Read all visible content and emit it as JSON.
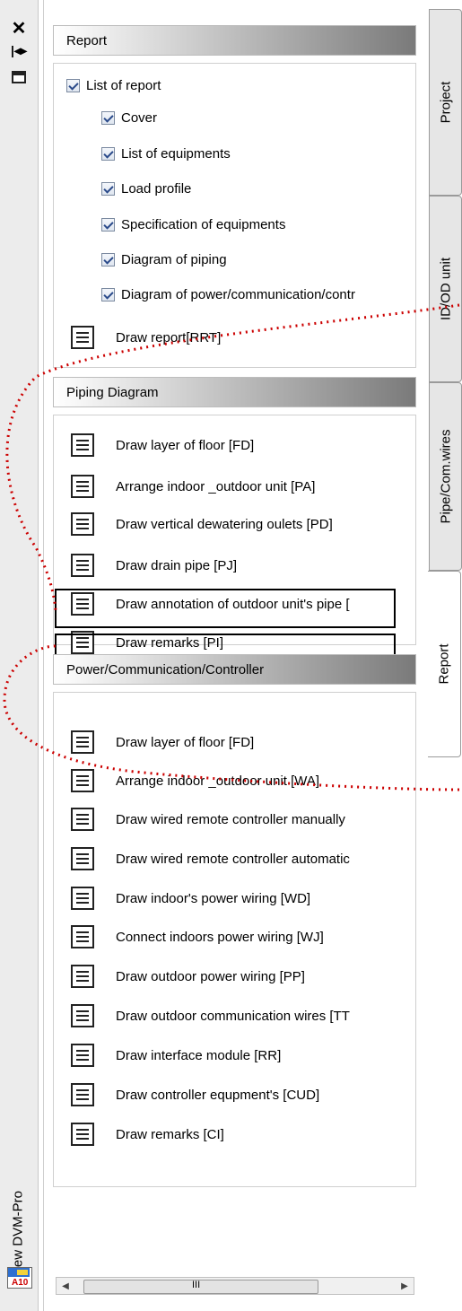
{
  "sidebar": {
    "title": "New DVM-Pro",
    "icons": [
      "close-icon",
      "auto-hide-icon",
      "properties-icon"
    ]
  },
  "tabs": [
    {
      "label": "Project",
      "active": false
    },
    {
      "label": "ID/OD unit",
      "active": false
    },
    {
      "label": "Pipe/Com.wires",
      "active": false
    },
    {
      "label": "Report",
      "active": true
    }
  ],
  "report": {
    "header": "Report",
    "list_label": "List of report",
    "items": [
      {
        "label": "Cover",
        "checked": true
      },
      {
        "label": "List of equipments",
        "checked": true
      },
      {
        "label": "Load profile",
        "checked": true
      },
      {
        "label": "Specification of equipments",
        "checked": true
      },
      {
        "label": "Diagram of piping",
        "checked": true
      },
      {
        "label": "Diagram of power/communication/contr",
        "checked": true
      }
    ],
    "draw_label": "Draw report[RRT]"
  },
  "piping": {
    "header": "Piping Diagram",
    "items": [
      "Draw layer of floor [FD]",
      "Arrange indoor _outdoor unit [PA]",
      "Draw vertical dewatering oulets [PD]",
      "Draw drain pipe [PJ]",
      "Draw annotation of outdoor unit's pipe [",
      "Draw remarks [PI]"
    ]
  },
  "power": {
    "header": "Power/Communication/Controller",
    "items": [
      "Draw layer of floor [FD]",
      "Arrange indoor _outdoor unit [WA]",
      "Draw wired remote controller manually",
      "Draw wired remote controller automatic",
      "Draw indoor's power wiring [WD]",
      "Connect indoors power wiring [WJ]",
      "Draw outdoor power wiring [PP]",
      "Draw outdoor communication wires [TT",
      "Draw interface module [RR]",
      "Draw controller equpment's [CUD]",
      "Draw remarks [CI]"
    ]
  },
  "scrollbar": {
    "thumb_label": "III"
  },
  "colors": {
    "annotation": "#cc0000"
  }
}
